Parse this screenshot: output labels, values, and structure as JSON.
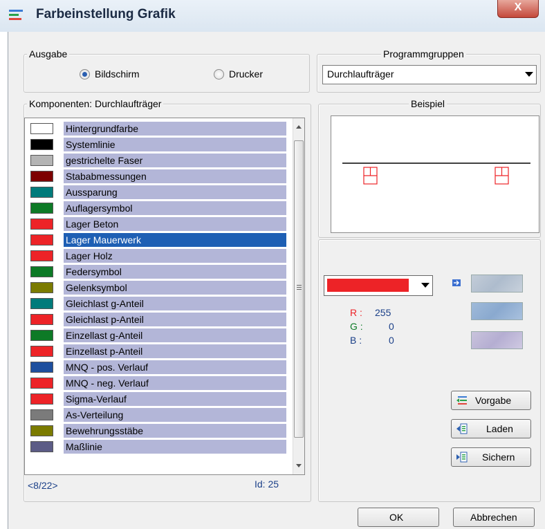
{
  "window": {
    "title": "Farbeinstellung Grafik",
    "close_label": "X"
  },
  "ausgabe": {
    "legend": "Ausgabe",
    "option_screen": "Bildschirm",
    "option_printer": "Drucker",
    "selected": "Bildschirm"
  },
  "programmgruppen": {
    "legend": "Programmgruppen",
    "selected": "Durchlaufträger"
  },
  "komponenten": {
    "legend": "Komponenten: Durchlaufträger",
    "selected_index": 7,
    "items": [
      {
        "label": "Hintergrundfarbe",
        "color": "#ffffff"
      },
      {
        "label": "Systemlinie",
        "color": "#000000"
      },
      {
        "label": "gestrichelte Faser",
        "color": "#b4b4b4"
      },
      {
        "label": "Stababmessungen",
        "color": "#7d0000"
      },
      {
        "label": "Aussparung",
        "color": "#007b7b"
      },
      {
        "label": "Auflagersymbol",
        "color": "#0d7a26"
      },
      {
        "label": "Lager Beton",
        "color": "#ed2327"
      },
      {
        "label": "Lager Mauerwerk",
        "color": "#ed2327"
      },
      {
        "label": "Lager Holz",
        "color": "#ed2327"
      },
      {
        "label": "Federsymbol",
        "color": "#0d7a26"
      },
      {
        "label": "Gelenksymbol",
        "color": "#7b7b00"
      },
      {
        "label": "Gleichlast g-Anteil",
        "color": "#007b7b"
      },
      {
        "label": "Gleichlast p-Anteil",
        "color": "#ed2327"
      },
      {
        "label": "Einzellast g-Anteil",
        "color": "#0d7a26"
      },
      {
        "label": "Einzellast p-Anteil",
        "color": "#ed2327"
      },
      {
        "label": "MNQ - pos. Verlauf",
        "color": "#1e4f9e"
      },
      {
        "label": "MNQ - neg. Verlauf",
        "color": "#ed2327"
      },
      {
        "label": "Sigma-Verlauf",
        "color": "#ed2327"
      },
      {
        "label": "As-Verteilung",
        "color": "#7b7b7b"
      },
      {
        "label": "Bewehrungsstäbe",
        "color": "#7b7b00"
      },
      {
        "label": "Maßlinie",
        "color": "#5c5c86"
      }
    ],
    "position": "<8/22>",
    "id_label": "Id: 25"
  },
  "beispiel": {
    "legend": "Beispiel"
  },
  "farbe": {
    "current_color": "#ed2327",
    "r_label": "R :",
    "r_value": "255",
    "g_label": "G :",
    "g_value": "0",
    "b_label": "B :",
    "b_value": "0"
  },
  "buttons": {
    "vorgabe": "Vorgabe",
    "laden": "Laden",
    "sichern": "Sichern",
    "ok": "OK",
    "abbrechen": "Abbrechen"
  }
}
